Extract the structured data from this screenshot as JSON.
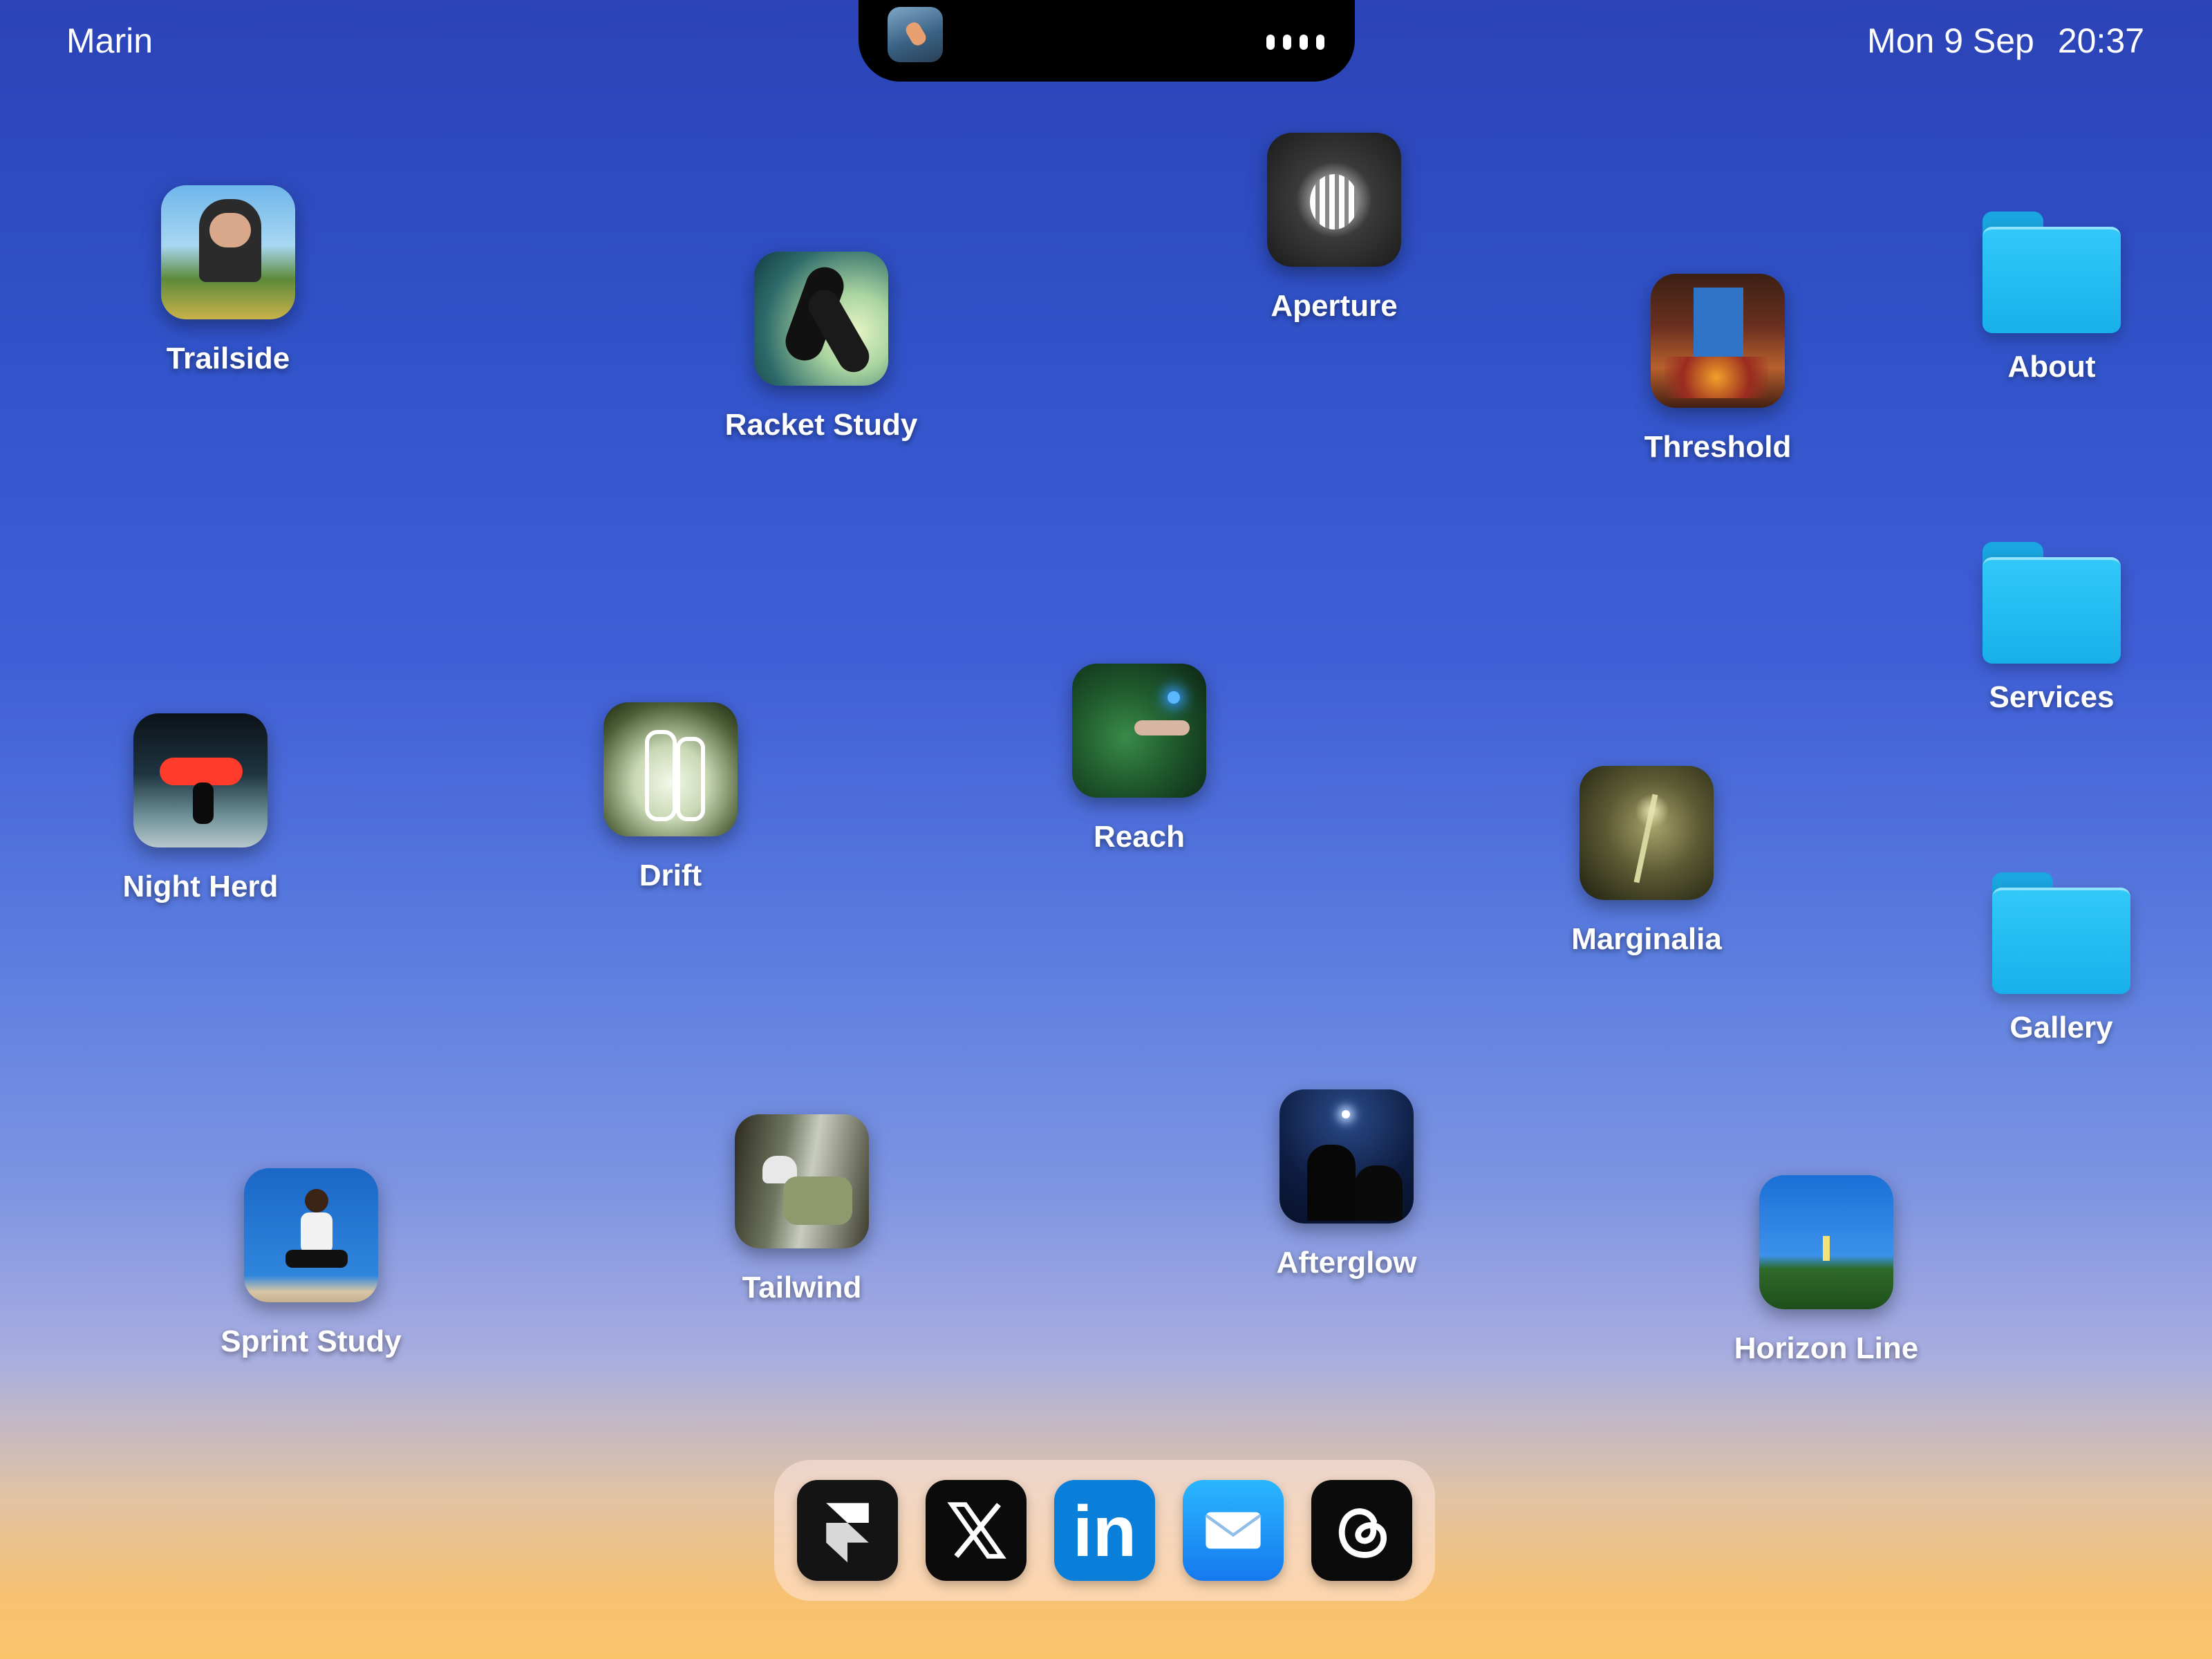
{
  "menubar": {
    "user": "Marin",
    "date": "Mon 9 Sep",
    "time": "20:37"
  },
  "island": {
    "dots": 4
  },
  "apps": [
    {
      "id": "trailside",
      "label": "Trailside"
    },
    {
      "id": "racket",
      "label": "Racket Study"
    },
    {
      "id": "aperture",
      "label": "Aperture"
    },
    {
      "id": "threshold",
      "label": "Threshold"
    },
    {
      "id": "nightherd",
      "label": "Night Herd"
    },
    {
      "id": "drift",
      "label": "Drift"
    },
    {
      "id": "reach",
      "label": "Reach"
    },
    {
      "id": "marginalia",
      "label": "Marginalia"
    },
    {
      "id": "sprint",
      "label": "Sprint Study"
    },
    {
      "id": "tailwind",
      "label": "Tailwind"
    },
    {
      "id": "afterglow",
      "label": "Afterglow"
    },
    {
      "id": "horizon",
      "label": "Horizon Line"
    }
  ],
  "folders": [
    {
      "label": "About"
    },
    {
      "label": "Services"
    },
    {
      "label": "Gallery"
    }
  ],
  "dock": [
    {
      "name": "framer-icon"
    },
    {
      "name": "x-icon"
    },
    {
      "name": "linkedin-icon"
    },
    {
      "name": "mail-icon"
    },
    {
      "name": "threads-icon"
    }
  ],
  "dock_labels": {
    "linkedin": "in"
  }
}
